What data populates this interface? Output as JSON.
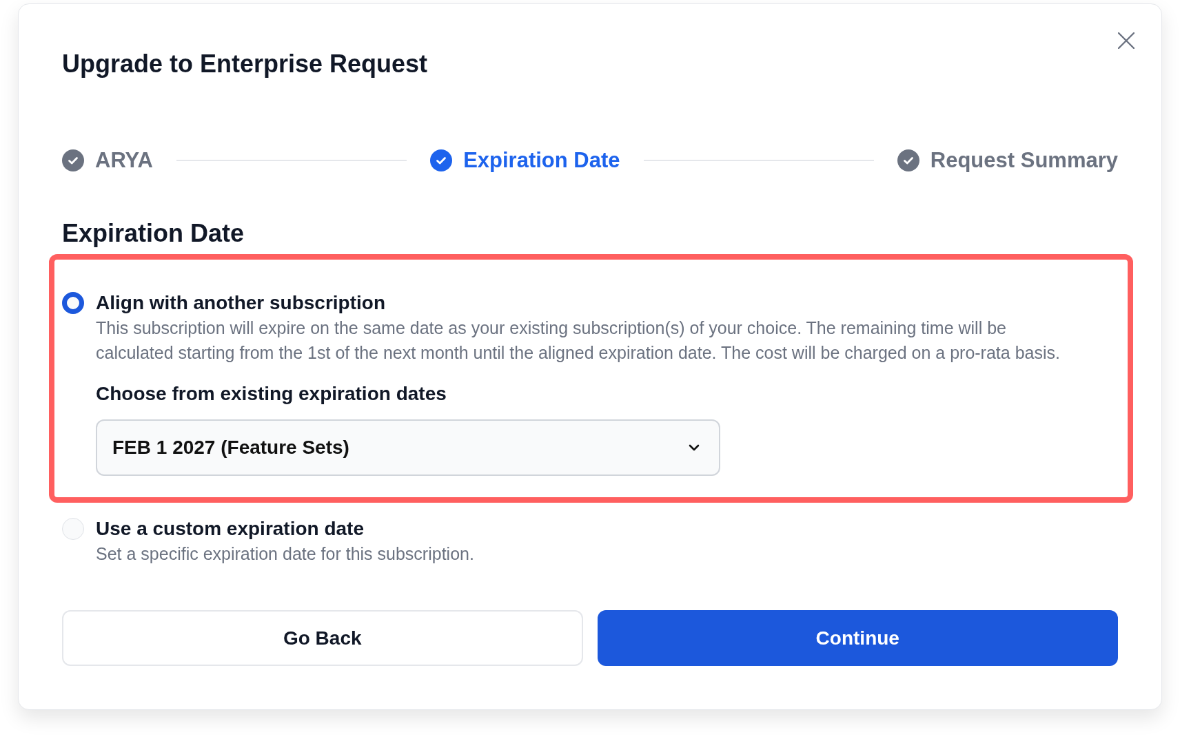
{
  "dialog": {
    "title": "Upgrade to Enterprise Request"
  },
  "steps": [
    {
      "label": "ARYA",
      "selected": false
    },
    {
      "label": "Expiration Date",
      "selected": true
    },
    {
      "label": "Request Summary",
      "selected": false
    }
  ],
  "section_title": "Expiration Date",
  "options": [
    {
      "title": "Align with another subscription",
      "description": "This subscription will expire on the same date as your existing subscription(s) of your choice. The remaining time will be calculated starting from the 1st of the next month until the aligned expiration date. The cost will be charged on a pro-rata basis.",
      "selected": true,
      "highlighted": true,
      "dropdown": {
        "label": "Choose from existing expiration dates",
        "value": "FEB 1 2027 (Feature Sets)"
      }
    },
    {
      "title": "Use a custom expiration date",
      "description": "Set a specific expiration date for this subscription.",
      "selected": false,
      "highlighted": false
    }
  ],
  "buttons": [
    {
      "label": "Go Back",
      "kind": "secondary"
    },
    {
      "label": "Continue",
      "kind": "primary"
    }
  ]
}
